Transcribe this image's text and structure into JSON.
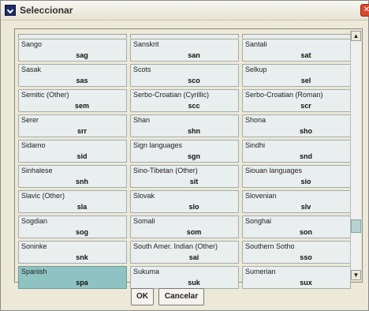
{
  "window": {
    "title": "Seleccionar"
  },
  "languages": [
    [
      {
        "name": "Sango",
        "code": "sag"
      },
      {
        "name": "Sanskrit",
        "code": "san"
      },
      {
        "name": "Santali",
        "code": "sat"
      }
    ],
    [
      {
        "name": "Sasak",
        "code": "sas"
      },
      {
        "name": "Scots",
        "code": "sco"
      },
      {
        "name": "Selkup",
        "code": "sel"
      }
    ],
    [
      {
        "name": "Semitic (Other)",
        "code": "sem"
      },
      {
        "name": "Serbo-Croatian (Cyrillic)",
        "code": "scc"
      },
      {
        "name": "Serbo-Croatian (Roman)",
        "code": "scr"
      }
    ],
    [
      {
        "name": "Serer",
        "code": "srr"
      },
      {
        "name": "Shan",
        "code": "shn"
      },
      {
        "name": "Shona",
        "code": "sho"
      }
    ],
    [
      {
        "name": "Sidamo",
        "code": "sid"
      },
      {
        "name": "Sign languages",
        "code": "sgn"
      },
      {
        "name": "Sindhi",
        "code": "snd"
      }
    ],
    [
      {
        "name": "Sinhalese",
        "code": "snh"
      },
      {
        "name": "Sino-Tibetan (Other)",
        "code": "sit"
      },
      {
        "name": "Siouan languages",
        "code": "sio"
      }
    ],
    [
      {
        "name": "Slavic (Other)",
        "code": "sla"
      },
      {
        "name": "Slovak",
        "code": "slo"
      },
      {
        "name": "Slovenian",
        "code": "slv"
      }
    ],
    [
      {
        "name": "Sogdian",
        "code": "sog"
      },
      {
        "name": "Somali",
        "code": "som"
      },
      {
        "name": "Songhai",
        "code": "son"
      }
    ],
    [
      {
        "name": "Soninke",
        "code": "snk"
      },
      {
        "name": "South Amer. Indian (Other)",
        "code": "sai"
      },
      {
        "name": "Southern Sotho",
        "code": "sso"
      }
    ],
    [
      {
        "name": "Spanish",
        "code": "spa",
        "selected": true
      },
      {
        "name": "Sukuma",
        "code": "suk"
      },
      {
        "name": "Sumerian",
        "code": "sux"
      }
    ]
  ],
  "buttons": {
    "ok": "OK",
    "cancel": "Cancelar"
  },
  "colors": {
    "selected": "#8fc3c3",
    "cell": "#e9eeee",
    "dialog": "#ece9d8"
  }
}
